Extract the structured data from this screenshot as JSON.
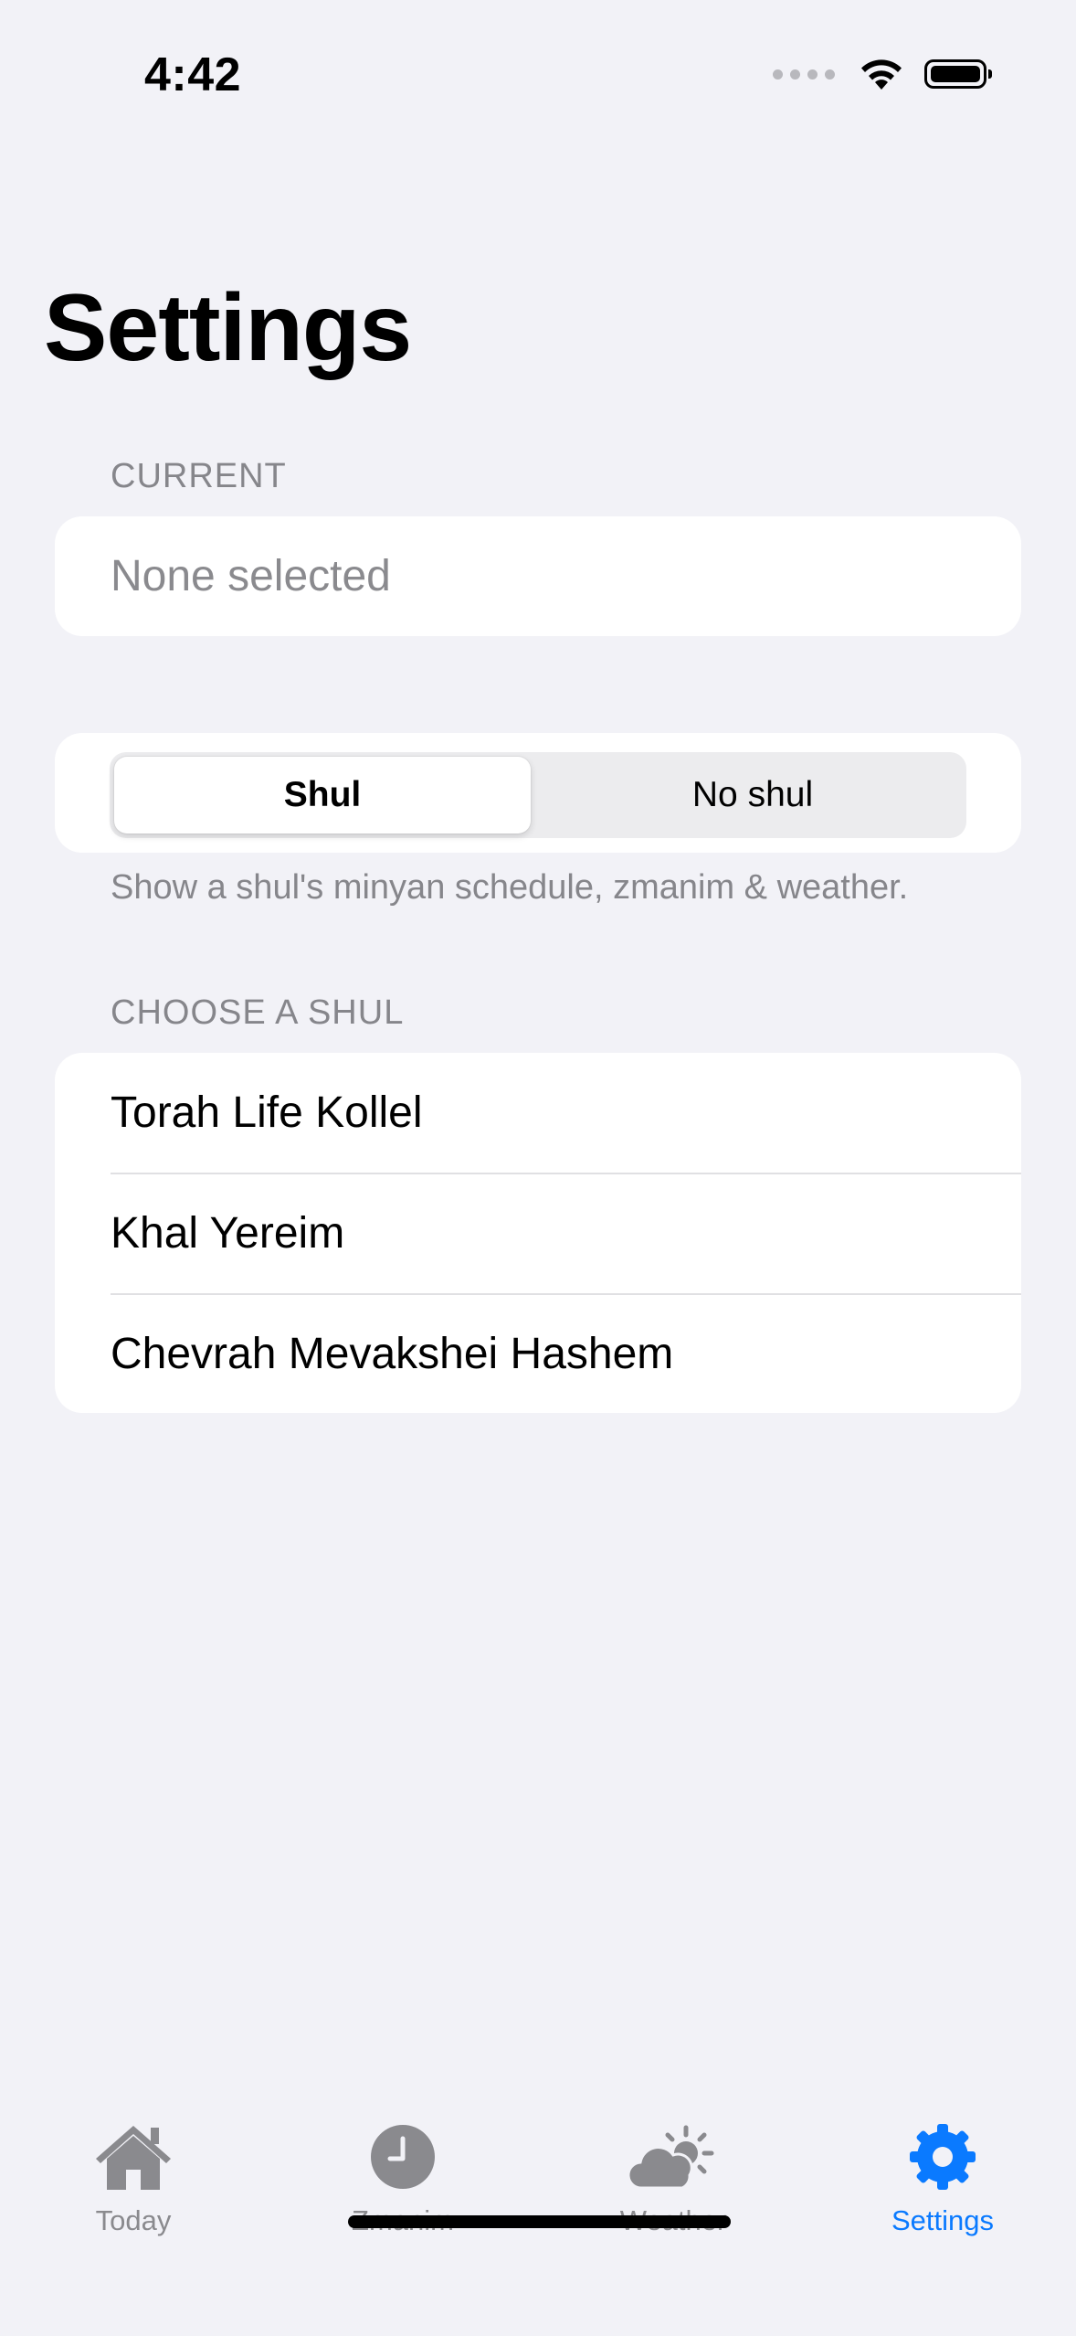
{
  "status_bar": {
    "time": "4:42"
  },
  "header": {
    "title": "Settings"
  },
  "current": {
    "header": "CURRENT",
    "value": "None selected"
  },
  "mode": {
    "segments": [
      "Shul",
      "No shul"
    ],
    "selected": "Shul",
    "footer": "Show a shul's minyan schedule, zmanim & weather."
  },
  "shuls": {
    "header": "CHOOSE A SHUL",
    "items": [
      "Torah Life Kollel",
      "Khal Yereim",
      "Chevrah Mevakshei Hashem"
    ]
  },
  "tab_bar": {
    "items": [
      {
        "label": "Today",
        "icon": "house-icon"
      },
      {
        "label": "Zmanim",
        "icon": "clock-icon"
      },
      {
        "label": "Weather",
        "icon": "cloud-sun-icon"
      },
      {
        "label": "Settings",
        "icon": "gear-icon"
      }
    ],
    "active": "Settings"
  },
  "colors": {
    "accent": "#0a7aff",
    "background": "#f2f2f7",
    "inactive": "#8a8a8e"
  }
}
